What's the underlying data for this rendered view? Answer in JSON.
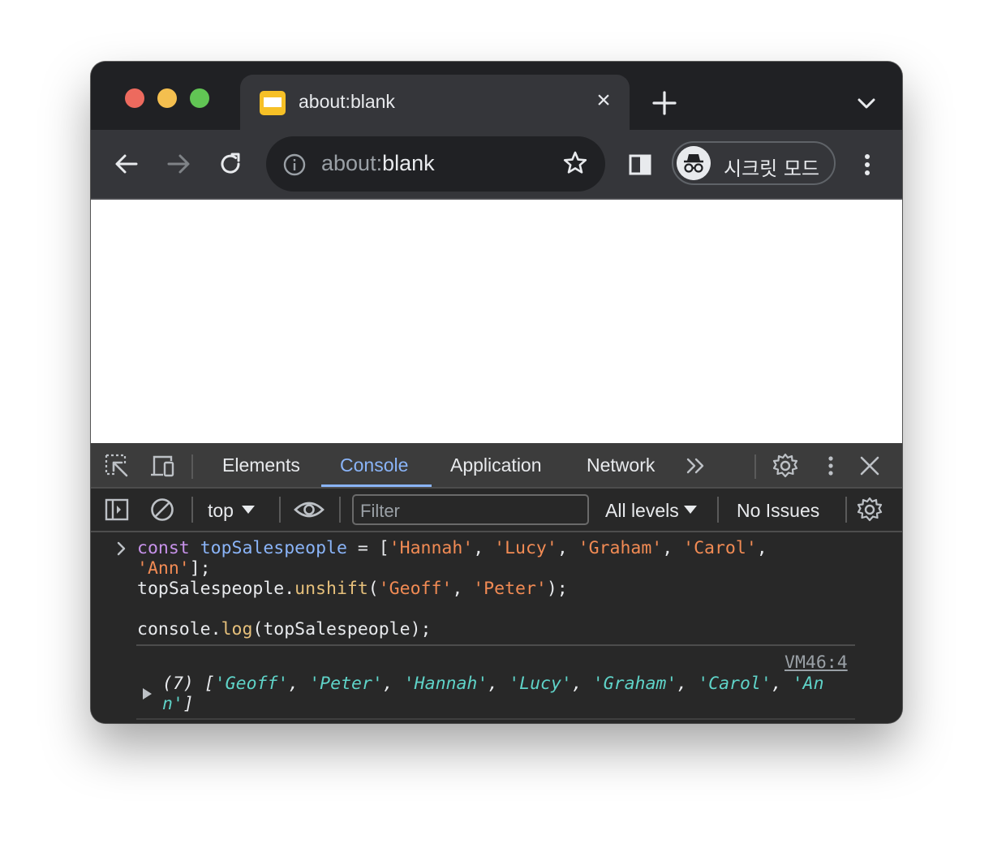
{
  "tab": {
    "title": "about:blank",
    "close_glyph": "×"
  },
  "toolbar": {
    "url_scheme": "about:",
    "url_host": "blank",
    "incognito_label": "시크릿 모드"
  },
  "devtools": {
    "tabs": [
      "Elements",
      "Console",
      "Application",
      "Network"
    ],
    "active_tab": "Console",
    "context": "top",
    "filter_placeholder": "Filter",
    "levels": "All levels",
    "issues": "No Issues"
  },
  "console": {
    "input_lines": [
      "const topSalespeople = ['Hannah', 'Lucy', 'Graham', 'Carol',",
      "'Ann'];",
      "topSalespeople.unshift('Geoff', 'Peter');",
      "",
      "console.log(topSalespeople);"
    ],
    "source_link": "VM46:4",
    "output_lines": [
      "(7) ['Geoff', 'Peter', 'Hannah', 'Lucy', 'Graham', 'Carol', 'An",
      "n']"
    ]
  },
  "colors": {
    "chrome_dark": "#202124",
    "toolbar": "#35363a",
    "devtools_bg": "#282828",
    "accent_blue": "#8ab4f8",
    "string_orange": "#f28b54",
    "output_teal": "#5fd3c8",
    "keyword_purple": "#c792ea"
  },
  "icons": [
    "close-window-light",
    "minimize-light",
    "maximize-light",
    "page-favicon",
    "close-icon",
    "plus-icon",
    "chevron-down-icon",
    "back-arrow-icon",
    "forward-arrow-icon",
    "reload-icon",
    "info-icon",
    "star-icon",
    "side-panel-icon",
    "incognito-icon",
    "more-vert-icon",
    "inspect-icon",
    "device-toggle-icon",
    "more-tabs-icon",
    "gear-icon",
    "sidebar-toggle-icon",
    "clear-console-icon",
    "eye-icon",
    "chevron-right-icon",
    "triangle-right-icon"
  ]
}
